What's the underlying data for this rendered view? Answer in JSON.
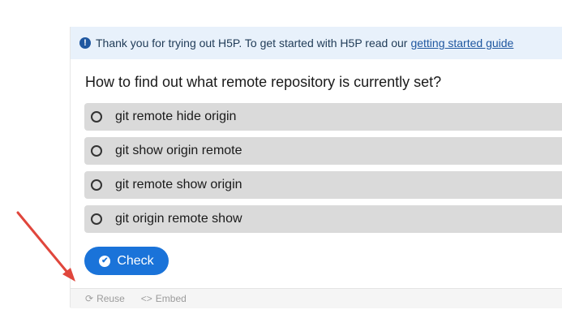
{
  "notice": {
    "text": "Thank you for trying out H5P. To get started with H5P read our",
    "link_text": "getting started guide"
  },
  "question": {
    "text": "How to find out what remote repository is currently set?"
  },
  "answers": [
    {
      "label": "git remote hide origin"
    },
    {
      "label": "git show origin remote"
    },
    {
      "label": "git remote show origin"
    },
    {
      "label": "git origin remote show"
    }
  ],
  "check_button": {
    "label": "Check"
  },
  "footer": {
    "reuse_label": "Reuse",
    "embed_label": "Embed"
  },
  "colors": {
    "notice_bg": "#e8f1fb",
    "answer_bg": "#dadada",
    "button_bg": "#1a73d9",
    "arrow": "#e0463c"
  },
  "icons": {
    "notice": "info-icon",
    "check": "check-circle-icon",
    "reuse": "refresh-icon",
    "embed": "code-icon"
  }
}
